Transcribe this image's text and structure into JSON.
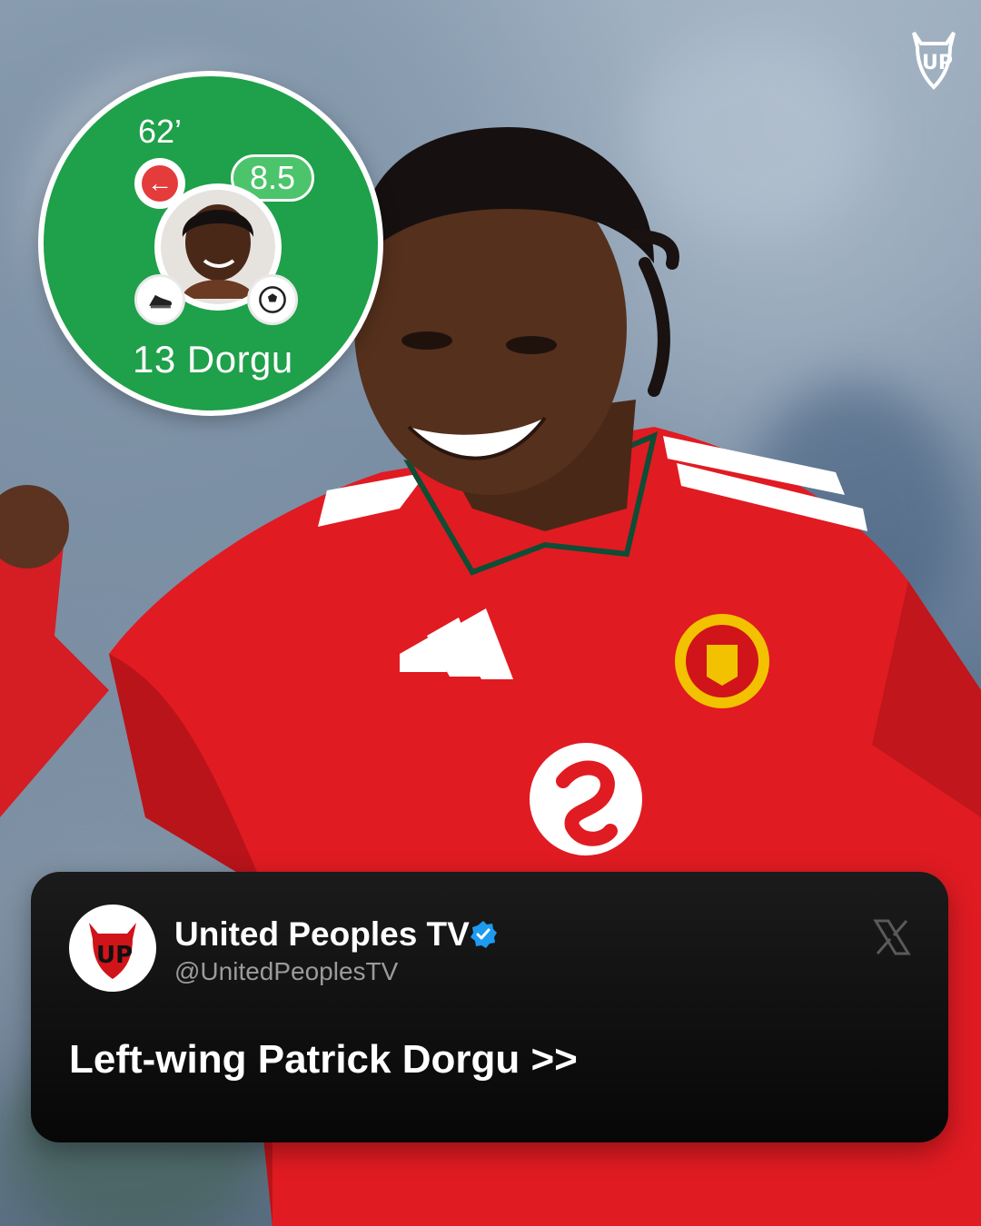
{
  "rating_card": {
    "minute": "62’",
    "rating": "8.5",
    "player_label": "13 Dorgu",
    "background_color": "#1fa04a",
    "sub_icon": "arrow-left-icon",
    "assist_icon": "football-boot-icon",
    "goal_icon": "football-icon"
  },
  "tweet": {
    "account_name": "United Peoples TV",
    "handle": "@UnitedPeoplesTV",
    "text": "Left-wing Patrick Dorgu >>",
    "verified": true,
    "platform_icon": "x-logo-icon"
  },
  "colors": {
    "kit_red": "#e11b22",
    "verified_blue": "#1d9bf0",
    "card_bg": "#0c0c0c"
  }
}
